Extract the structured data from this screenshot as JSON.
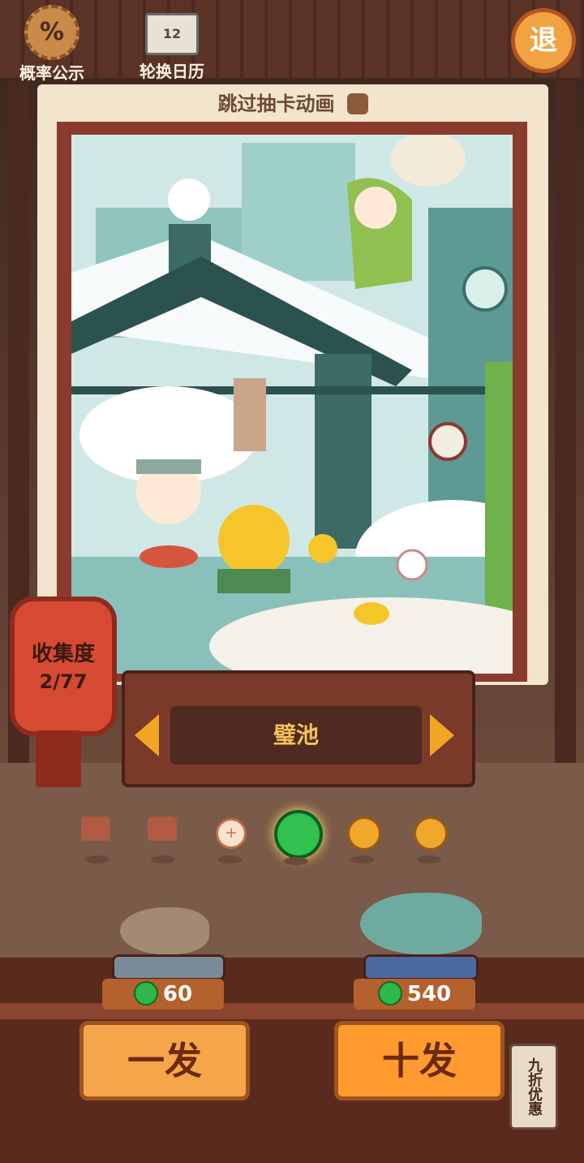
{
  "header": {
    "probability_label": "概率公示",
    "probability_icon": "%",
    "calendar_label": "轮换日历",
    "calendar_icon": "12",
    "exit_label": "退"
  },
  "skip_animation": {
    "label": "跳过抽卡动画",
    "checked": false
  },
  "collection": {
    "label": "收集度",
    "value": "2/77"
  },
  "banner": {
    "name": "璧池",
    "selected_index": 3,
    "total": 6
  },
  "pull": {
    "single": {
      "label": "一发",
      "cost": "60"
    },
    "ten": {
      "label": "十发",
      "cost": "540"
    },
    "discount_tag": "九折优惠"
  },
  "colors": {
    "accent": "#f3a624",
    "gem": "#2fb84a",
    "wood": "#7a3a2a"
  }
}
